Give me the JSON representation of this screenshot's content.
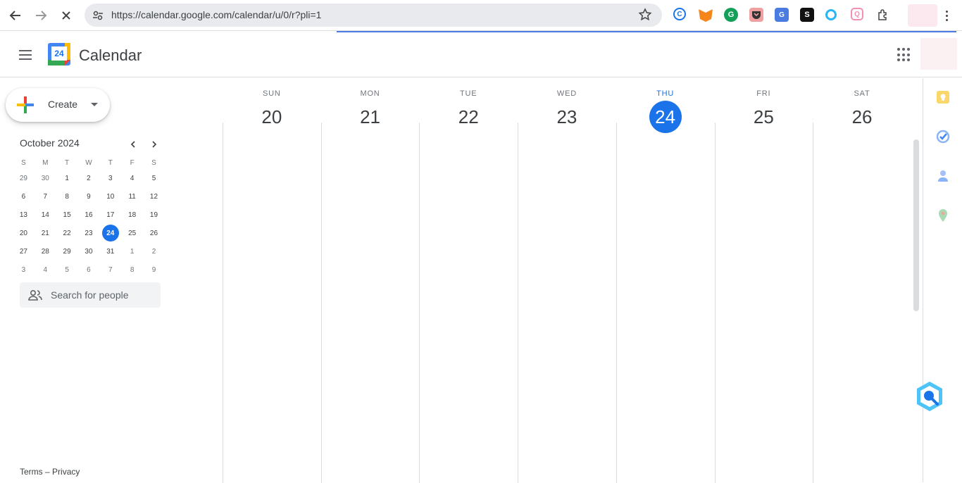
{
  "browser": {
    "url": "https://calendar.google.com/calendar/u/0/r?pli=1"
  },
  "app": {
    "title": "Calendar",
    "logo_day": "24"
  },
  "create": {
    "label": "Create"
  },
  "mini_calendar": {
    "title": "October 2024",
    "weekday_headers": [
      "S",
      "M",
      "T",
      "W",
      "T",
      "F",
      "S"
    ],
    "weeks": [
      [
        {
          "d": "29",
          "dim": true
        },
        {
          "d": "30",
          "dim": true
        },
        {
          "d": "1"
        },
        {
          "d": "2"
        },
        {
          "d": "3"
        },
        {
          "d": "4"
        },
        {
          "d": "5"
        }
      ],
      [
        {
          "d": "6"
        },
        {
          "d": "7"
        },
        {
          "d": "8"
        },
        {
          "d": "9"
        },
        {
          "d": "10"
        },
        {
          "d": "11"
        },
        {
          "d": "12"
        }
      ],
      [
        {
          "d": "13"
        },
        {
          "d": "14"
        },
        {
          "d": "15"
        },
        {
          "d": "16"
        },
        {
          "d": "17"
        },
        {
          "d": "18"
        },
        {
          "d": "19"
        }
      ],
      [
        {
          "d": "20"
        },
        {
          "d": "21"
        },
        {
          "d": "22"
        },
        {
          "d": "23"
        },
        {
          "d": "24",
          "today": true
        },
        {
          "d": "25"
        },
        {
          "d": "26"
        }
      ],
      [
        {
          "d": "27"
        },
        {
          "d": "28"
        },
        {
          "d": "29"
        },
        {
          "d": "30"
        },
        {
          "d": "31"
        },
        {
          "d": "1",
          "dim": true
        },
        {
          "d": "2",
          "dim": true
        }
      ],
      [
        {
          "d": "3",
          "dim": true
        },
        {
          "d": "4",
          "dim": true
        },
        {
          "d": "5",
          "dim": true
        },
        {
          "d": "6",
          "dim": true
        },
        {
          "d": "7",
          "dim": true
        },
        {
          "d": "8",
          "dim": true
        },
        {
          "d": "9",
          "dim": true
        }
      ]
    ]
  },
  "search_people": {
    "placeholder": "Search for people"
  },
  "footer": {
    "terms": "Terms",
    "separator": "–",
    "privacy": "Privacy"
  },
  "week": {
    "days": [
      {
        "name": "SUN",
        "num": "20"
      },
      {
        "name": "MON",
        "num": "21"
      },
      {
        "name": "TUE",
        "num": "22"
      },
      {
        "name": "WED",
        "num": "23"
      },
      {
        "name": "THU",
        "num": "24",
        "today": true
      },
      {
        "name": "FRI",
        "num": "25"
      },
      {
        "name": "SAT",
        "num": "26"
      }
    ]
  },
  "colors": {
    "accent": "#1a73e8",
    "divider": "#dadce0"
  }
}
